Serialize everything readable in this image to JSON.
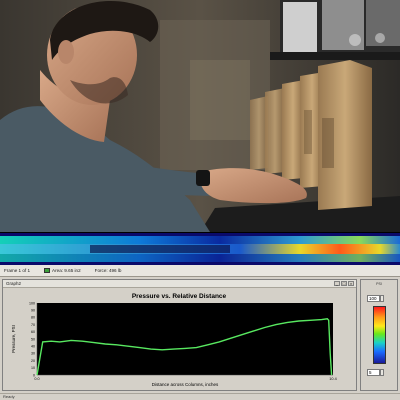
{
  "info_bar": {
    "frame": "Frame 1 of 1",
    "area": "Area: 9.65 in2",
    "force": "Force: 496 lb"
  },
  "graph_window": {
    "title": "Graph2",
    "minimize_label": "_",
    "maximize_label": "□",
    "close_label": "×"
  },
  "chart_data": {
    "type": "line",
    "title": "Pressure vs. Relative Distance",
    "xlabel": "Distance across Columns, inches",
    "ylabel": "Pressure, PSI",
    "xlim": [
      0,
      10.4
    ],
    "ylim": [
      0,
      100
    ],
    "x_tick_labels": [
      "0.0",
      "10.4"
    ],
    "y_tick_labels": [
      "100",
      "90",
      "80",
      "70",
      "60",
      "50",
      "40",
      "30",
      "20",
      "10",
      "0"
    ],
    "grid": false,
    "line_color": "#58e860",
    "background": "#000000",
    "series": [
      {
        "x": [
          0.0,
          0.2,
          0.5,
          0.8,
          1.2,
          1.6,
          2.0,
          2.4,
          2.8,
          3.2,
          3.6,
          4.0,
          4.4,
          4.8,
          5.2,
          5.6,
          6.0,
          6.4,
          6.8,
          7.2,
          7.6,
          8.0,
          8.4,
          8.8,
          9.2,
          9.6,
          10.0,
          10.2,
          10.25,
          10.3,
          10.35
        ],
        "y": [
          0,
          46,
          47,
          46,
          48,
          47,
          45,
          43,
          42,
          40,
          38,
          36,
          35,
          36,
          37,
          38,
          42,
          46,
          51,
          56,
          61,
          66,
          70,
          73,
          75,
          76,
          77,
          78,
          76,
          30,
          0
        ]
      }
    ]
  },
  "side_panel": {
    "label": "PSI",
    "max_value": "100",
    "min_value": "5"
  },
  "status_bar": {
    "text": "Ready"
  }
}
